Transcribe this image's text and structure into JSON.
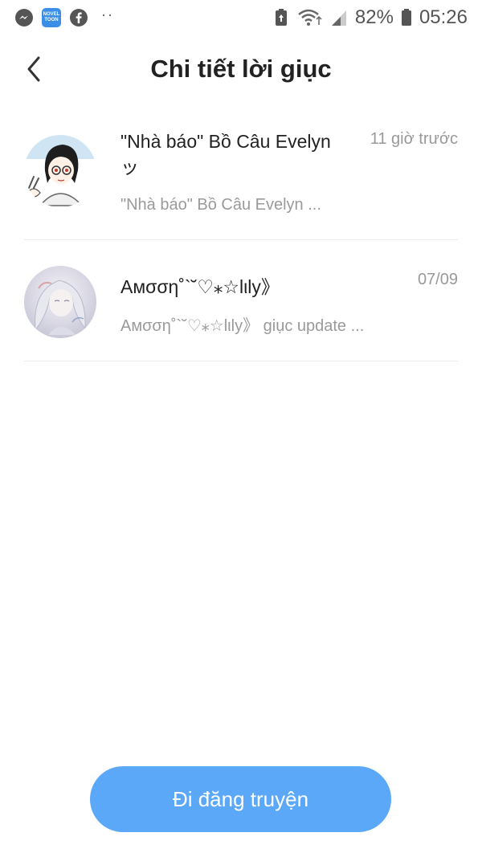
{
  "status_bar": {
    "novel_badge_line1": "NOVEL",
    "novel_badge_line2": "TOON",
    "dots": "··",
    "battery_percent": "82%",
    "time": "05:26"
  },
  "header": {
    "title": "Chi tiết lời giục"
  },
  "items": [
    {
      "name": "\"Nhà báo\" Bồ Câu Evelyn ッ",
      "time": "11 giờ trước",
      "preview": "\"Nhà báo\" Bồ Câu Evelyn ..."
    },
    {
      "name": "Aмσση˚`˘♡⁎☆lιly》",
      "time": "07/09",
      "preview": "Aмσση˚`˘♡⁎☆lιly》 giục update ..."
    }
  ],
  "publish_button": {
    "label": "Đi đăng truyện"
  },
  "colors": {
    "accent": "#5aa8f7",
    "muted_text": "#999999",
    "divider": "#ececec"
  }
}
